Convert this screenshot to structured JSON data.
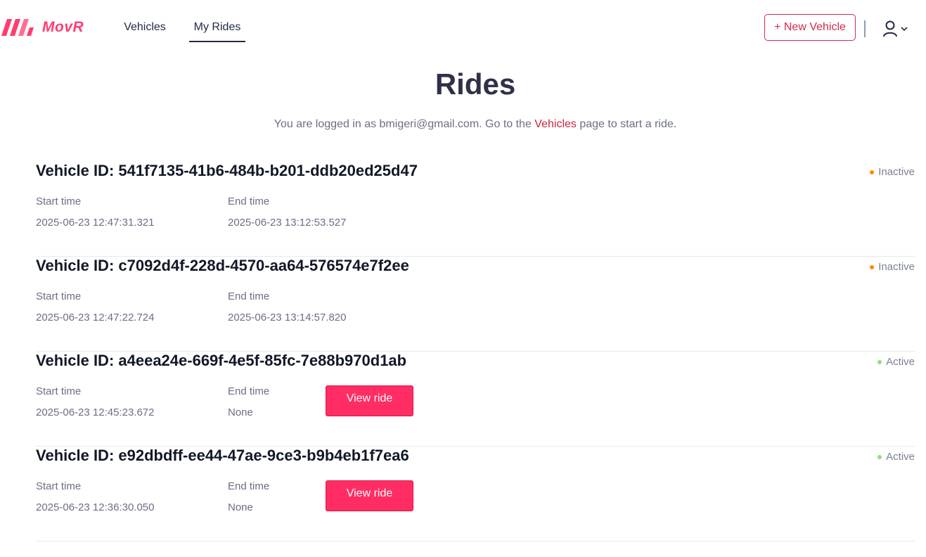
{
  "header": {
    "logo_text": "MovR",
    "brand_color": "#ff3d71",
    "nav": [
      {
        "label": "Vehicles",
        "active": false
      },
      {
        "label": "My Rides",
        "active": true
      }
    ],
    "new_vehicle_label": "+ New Vehicle",
    "user_icon": "user-icon",
    "chevron_icon": "chevron-down-icon"
  },
  "page": {
    "title": "Rides",
    "subtitle_prefix": "You are logged in as bmigeri@gmail.com. Go to the ",
    "subtitle_link": "Vehicles",
    "subtitle_suffix": " page to start a ride."
  },
  "labels": {
    "start_time": "Start time",
    "end_time": "End time",
    "view_ride": "View ride"
  },
  "status_colors": {
    "Inactive": "#ff8a00",
    "Active": "#8be07c"
  },
  "rides": [
    {
      "title": "Vehicle ID: 541f7135-41b6-484b-b201-ddb20ed25d47",
      "status": "Inactive",
      "start": "2025-06-23 12:47:31.321",
      "end": "2025-06-23 13:12:53.527",
      "viewable": false
    },
    {
      "title": "Vehicle ID: c7092d4f-228d-4570-aa64-576574e7f2ee",
      "status": "Inactive",
      "start": "2025-06-23 12:47:22.724",
      "end": "2025-06-23 13:14:57.820",
      "viewable": false
    },
    {
      "title": "Vehicle ID: a4eea24e-669f-4e5f-85fc-7e88b970d1ab",
      "status": "Active",
      "start": "2025-06-23 12:45:23.672",
      "end": "None",
      "viewable": true
    },
    {
      "title": "Vehicle ID: e92dbdff-ee44-47ae-9ce3-b9b4eb1f7ea6",
      "status": "Active",
      "start": "2025-06-23 12:36:30.050",
      "end": "None",
      "viewable": true
    }
  ]
}
